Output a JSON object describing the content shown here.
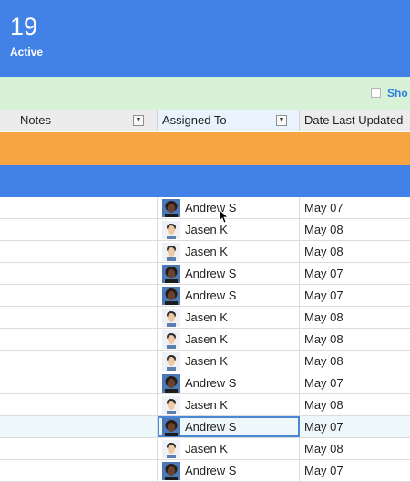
{
  "summary": {
    "count": "19",
    "label": "Active"
  },
  "filter": {
    "checkbox_label": "Sho"
  },
  "columns": [
    {
      "label": "Notes"
    },
    {
      "label": "Assigned To"
    },
    {
      "label": "Date Last Updated"
    }
  ],
  "rows": [
    {
      "assignee": "Andrew S",
      "date": "May 07",
      "avatar": "avatar-andrew"
    },
    {
      "assignee": "Jasen K",
      "date": "May 08",
      "avatar": "avatar-jasen"
    },
    {
      "assignee": "Jasen K",
      "date": "May 08",
      "avatar": "avatar-jasen"
    },
    {
      "assignee": "Andrew S",
      "date": "May 07",
      "avatar": "avatar-andrew"
    },
    {
      "assignee": "Andrew S",
      "date": "May 07",
      "avatar": "avatar-andrew"
    },
    {
      "assignee": "Jasen K",
      "date": "May 08",
      "avatar": "avatar-jasen"
    },
    {
      "assignee": "Jasen K",
      "date": "May 08",
      "avatar": "avatar-jasen"
    },
    {
      "assignee": "Jasen K",
      "date": "May 08",
      "avatar": "avatar-jasen"
    },
    {
      "assignee": "Andrew S",
      "date": "May 07",
      "avatar": "avatar-andrew"
    },
    {
      "assignee": "Jasen K",
      "date": "May 08",
      "avatar": "avatar-jasen"
    },
    {
      "assignee": "Andrew S",
      "date": "May 07",
      "avatar": "avatar-andrew"
    },
    {
      "assignee": "Jasen K",
      "date": "May 08",
      "avatar": "avatar-jasen"
    },
    {
      "assignee": "Andrew S",
      "date": "May 07",
      "avatar": "avatar-andrew"
    }
  ],
  "colors": {
    "banner": "#4281e6",
    "filter_bar": "#d7f2d6",
    "orange_group": "#f6a542",
    "blue_group": "#4281e6",
    "selection_outline": "#4a88d6"
  }
}
